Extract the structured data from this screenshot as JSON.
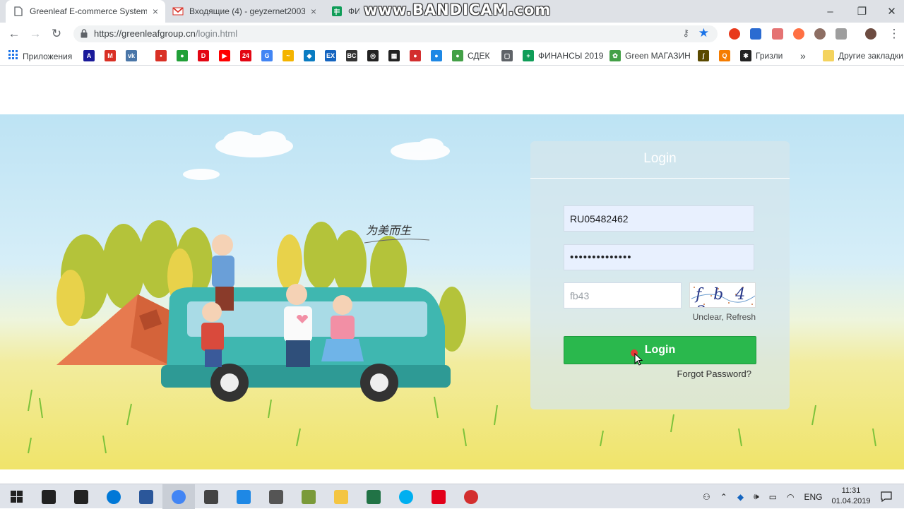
{
  "tabs": [
    {
      "title": "Greenleaf E-commerce System",
      "close": "×",
      "icon": "page-icon"
    },
    {
      "title": "Входящие (4) - geyzernet2003@",
      "close": "×",
      "icon": "gmail-icon"
    },
    {
      "title": "ФИН",
      "icon": "sheets-icon"
    }
  ],
  "watermark": "www.BANDICAM.com",
  "window_controls": {
    "minimize": "–",
    "restore": "❐",
    "close": "✕"
  },
  "address": {
    "url_main": "https://greenleafgroup.cn",
    "url_path": "/login.html"
  },
  "bookmarks": {
    "apps": "Приложения",
    "items": [
      {
        "icon": "A",
        "color": "#1a1a9a"
      },
      {
        "icon": "M",
        "color": "#d93025"
      },
      {
        "icon": "vk",
        "color": "#4a76a8"
      },
      {
        "icon": "•",
        "color": "#d93025"
      },
      {
        "icon": "●",
        "color": "#21a038"
      },
      {
        "icon": "D",
        "color": "#e30613"
      },
      {
        "icon": "▶",
        "color": "#ff0000"
      },
      {
        "icon": "24",
        "color": "#e30613"
      },
      {
        "icon": "G",
        "color": "#4285f4"
      },
      {
        "icon": "~",
        "color": "#f4b400"
      },
      {
        "icon": "◆",
        "color": "#0a7cc2"
      },
      {
        "icon": "EX",
        "color": "#1565c0"
      },
      {
        "icon": "BC",
        "color": "#333333"
      },
      {
        "icon": "◎",
        "color": "#222222"
      },
      {
        "icon": "▦",
        "color": "#222222"
      },
      {
        "icon": "●",
        "color": "#d32f2f"
      },
      {
        "icon": "●",
        "color": "#1e88e5"
      }
    ],
    "named": [
      {
        "label": "СДЕК",
        "icon": "●",
        "color": "#43a047"
      },
      {
        "label": "",
        "icon": "▢",
        "color": "#5f6368"
      },
      {
        "label": "ФИНАНСЫ 2019",
        "icon": "+",
        "color": "#0f9d58"
      },
      {
        "label": "Green МАГАЗИН",
        "icon": "✿",
        "color": "#43a047"
      },
      {
        "label": "",
        "icon": "ʃ",
        "color": "#5a4a00"
      },
      {
        "label": "",
        "icon": "Q",
        "color": "#f57c00"
      },
      {
        "label": "Гризли",
        "icon": "✱",
        "color": "#222222"
      }
    ],
    "more": "»",
    "other": "Другие закладки"
  },
  "login": {
    "title": "Login",
    "username": "RU05482462",
    "password": "••••••••••••••",
    "captcha_input": "fb43",
    "captcha_image": "f b 4 3",
    "refresh": "Unclear, Refresh",
    "button": "Login",
    "forgot": "Forgot Password?"
  },
  "hero": {
    "motto": "为美而生"
  },
  "taskbar": {
    "items": [
      {
        "icon": "cortana-search-icon",
        "color": "#222222"
      },
      {
        "icon": "task-view-icon",
        "color": "#222222"
      },
      {
        "icon": "edge-icon",
        "color": "#0078d7"
      },
      {
        "icon": "word-icon",
        "color": "#2b579a"
      },
      {
        "icon": "chrome-icon",
        "color": "#4285f4"
      },
      {
        "icon": "calculator-icon",
        "color": "#444444"
      },
      {
        "icon": "app-icon",
        "color": "#1e88e5"
      },
      {
        "icon": "printer-icon",
        "color": "#555555"
      },
      {
        "icon": "app-icon",
        "color": "#7a9a3a"
      },
      {
        "icon": "folder-icon",
        "color": "#f4c542"
      },
      {
        "icon": "excel-icon",
        "color": "#217346"
      },
      {
        "icon": "skype-icon",
        "color": "#00aff0"
      },
      {
        "icon": "acrobat-icon",
        "color": "#e2001a"
      },
      {
        "icon": "record-icon",
        "color": "#d32f2f"
      }
    ],
    "lang": "ENG",
    "time": "11:31",
    "date": "01.04.2019"
  }
}
